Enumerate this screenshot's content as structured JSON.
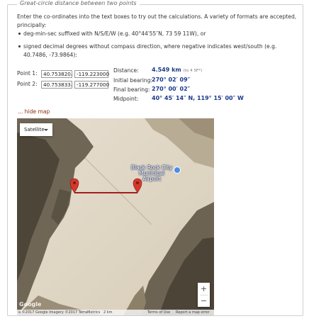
{
  "legend": "Great-circle distance between two points",
  "intro": "Enter the co-ordinates into the text boxes to try out the calculations. A variety of formats are accepted, principally:",
  "bullets": [
    "deg-min-sec suffixed with N/S/E/W (e.g. 40°44′55″N, 73 59 11W), or",
    "signed decimal degrees without compass direction, where negative indicates west/south (e.g. 40.7486, -73.9864):"
  ],
  "points": [
    {
      "label": "Point 1:",
      "lat": "40.753820",
      "lon": "-119.223000"
    },
    {
      "label": "Point 2:",
      "lat": "40.753833",
      "lon": "-119.277000"
    }
  ],
  "comma": ",",
  "results": {
    "distance_label": "Distance:",
    "distance_value": "4.549",
    "distance_unit": "km",
    "distance_sub": "(to 4 SF*)",
    "initial_label": "Initial bearing:",
    "initial_value": "270° 02′ 09″",
    "final_label": "Final bearing:",
    "final_value": "270° 00′ 02″",
    "midpoint_label": "Midpoint:",
    "midpoint_value": "40° 45′ 14″ N, 119° 15′ 00″ W"
  },
  "hide_map_label": "... hide map",
  "map": {
    "map_type": "Satellite",
    "place_label": "Black Rock City Municipal Airport",
    "zoom_in": "+",
    "zoom_out": "−",
    "google_logo": "Google",
    "attribution": "a ©2017 Google Imagery ©2017 TerraMetrics",
    "scale": "2 km",
    "terms": "Terms of Use",
    "report": "Report a map error",
    "marker_color": "#d6382c",
    "route_color": "#a31d1d"
  }
}
